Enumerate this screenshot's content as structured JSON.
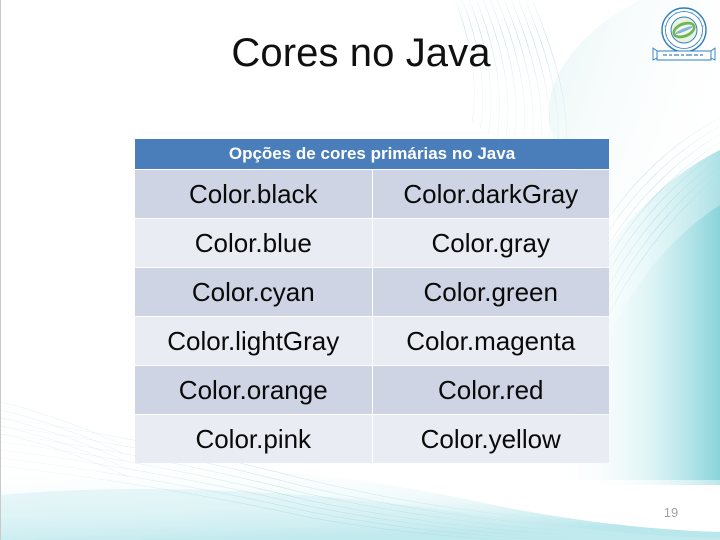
{
  "slide": {
    "title": "Cores no Java",
    "number": "19",
    "accent_blue": "#4a7ebb",
    "row_odd_bg": "#ced4e3",
    "row_even_bg": "#e9ecf3",
    "decor_teal": "#7fd4d8",
    "title_color": "#101010",
    "number_color": "#a3a3a3"
  },
  "logo": {
    "name": "institution-seal-logo",
    "ring_color": "#2f7fbf",
    "emblem_color": "#5aa83a",
    "banner_color": "#2f7fbf"
  },
  "table": {
    "header": "Opções de cores primárias no Java",
    "rows": [
      {
        "left": "Color.black",
        "right": "Color.darkGray"
      },
      {
        "left": "Color.blue",
        "right": "Color.gray"
      },
      {
        "left": "Color.cyan",
        "right": "Color.green"
      },
      {
        "left": "Color.lightGray",
        "right": "Color.magenta"
      },
      {
        "left": "Color.orange",
        "right": "Color.red"
      },
      {
        "left": "Color.pink",
        "right": "Color.yellow"
      }
    ]
  }
}
